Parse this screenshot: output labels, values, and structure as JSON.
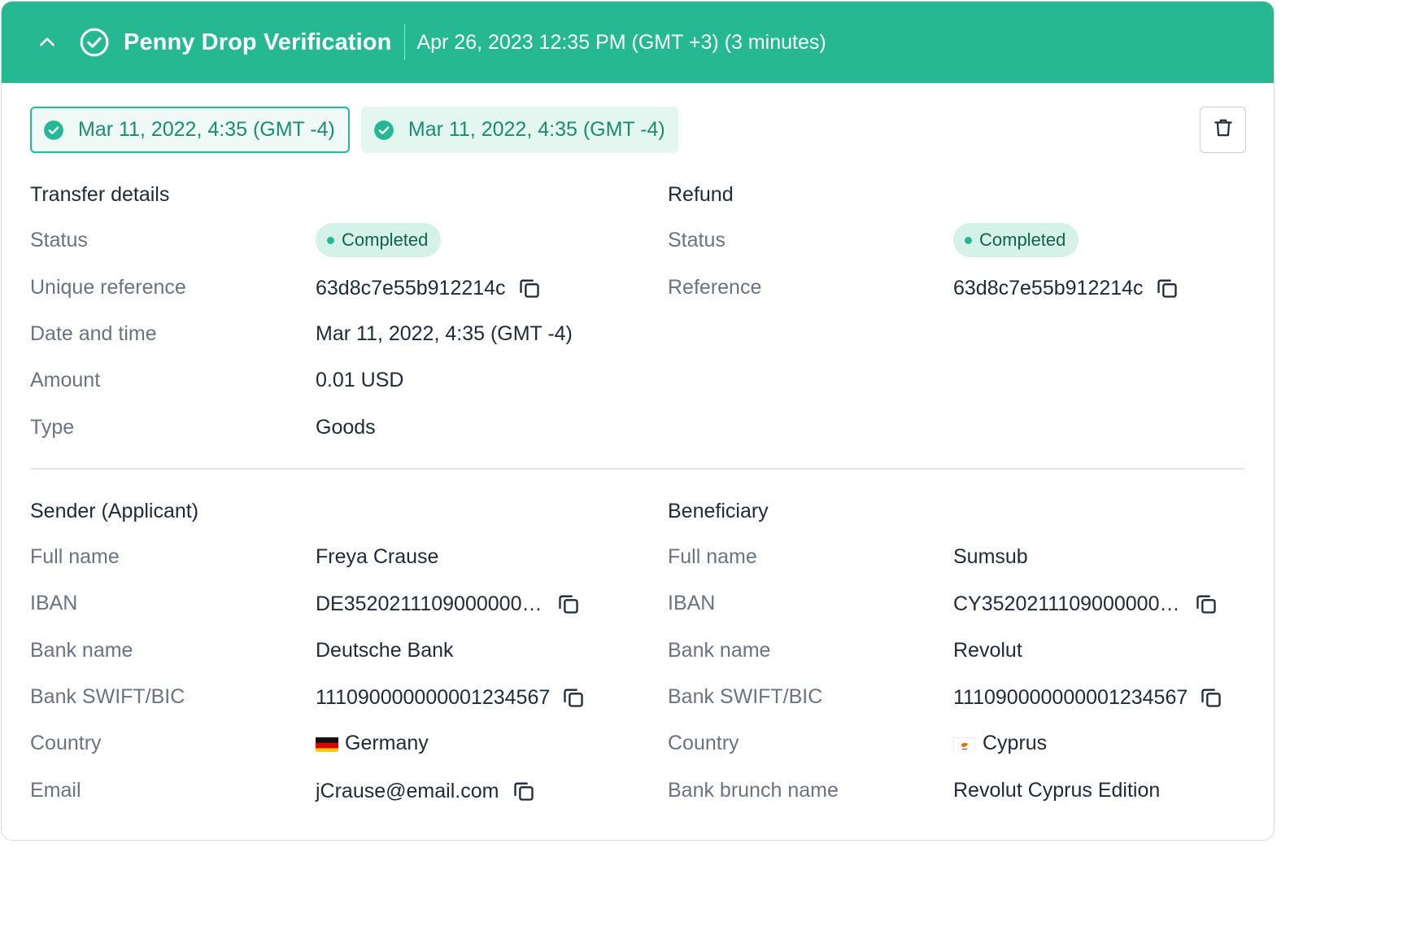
{
  "header": {
    "title": "Penny Drop Verification",
    "subtitle": "Apr 26, 2023 12:35 PM (GMT +3) (3 minutes)"
  },
  "chips": [
    {
      "label": "Mar 11, 2022, 4:35 (GMT -4)",
      "selected": true
    },
    {
      "label": "Mar 11, 2022, 4:35 (GMT -4)",
      "selected": false
    }
  ],
  "transfer": {
    "title": "Transfer details",
    "status_label": "Status",
    "status_value": "Completed",
    "reference_label": "Unique reference",
    "reference_value": "63d8c7e55b912214c",
    "date_label": "Date and time",
    "date_value": "Mar 11, 2022, 4:35 (GMT -4)",
    "amount_label": "Amount",
    "amount_value": "0.01 USD",
    "type_label": "Type",
    "type_value": "Goods"
  },
  "refund": {
    "title": "Refund",
    "status_label": "Status",
    "status_value": "Completed",
    "reference_label": "Reference",
    "reference_value": "63d8c7e55b912214c"
  },
  "sender": {
    "title": "Sender (Applicant)",
    "name_label": "Full name",
    "name_value": "Freya Crause",
    "iban_label": "IBAN",
    "iban_value": "DE3520211109000000…",
    "bank_label": "Bank name",
    "bank_value": "Deutsche Bank",
    "swift_label": "Bank SWIFT/BIC",
    "swift_value": "111090000000001234567",
    "country_label": "Country",
    "country_value": "Germany",
    "email_label": "Email",
    "email_value": "jCrause@email.com"
  },
  "beneficiary": {
    "title": "Beneficiary",
    "name_label": "Full name",
    "name_value": "Sumsub",
    "iban_label": "IBAN",
    "iban_value": "CY3520211109000000…",
    "bank_label": "Bank name",
    "bank_value": "Revolut",
    "swift_label": "Bank SWIFT/BIC",
    "swift_value": "111090000000001234567",
    "country_label": "Country",
    "country_value": "Cyprus",
    "branch_label": "Bank brunch name",
    "branch_value": "Revolut Cyprus Edition"
  },
  "colors": {
    "accent": "#26b893",
    "badge_bg": "#d4f2e8",
    "label": "#6b7280",
    "text": "#1f2937"
  },
  "icons": {
    "collapse": "chevron-up-icon",
    "verified": "check-circle-icon",
    "delete": "trash-icon",
    "copy": "copy-icon"
  }
}
